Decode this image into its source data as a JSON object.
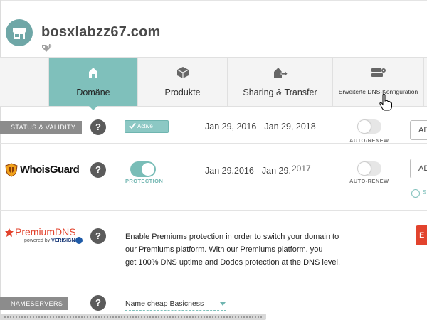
{
  "header": {
    "domain": "bosxlabzz67.com"
  },
  "tabs": [
    {
      "label": "Domäne",
      "icon": "home-icon",
      "active": true
    },
    {
      "label": "Produkte",
      "icon": "box-icon",
      "active": false
    },
    {
      "label": "Sharing & Transfer",
      "icon": "house-arrow-icon",
      "active": false
    },
    {
      "label": "Erweiterte DNS-Konfiguration",
      "icon": "server-gear-icon",
      "active": false
    }
  ],
  "status_row": {
    "label": "STATUS & VALIDITY",
    "help": "?",
    "badge": "Active",
    "dates": "Jan 29, 2016 - Jan 29, 2018",
    "auto_renew_label": "AUTO-RENEW",
    "auto_renew_on": false,
    "edge_button": "AD"
  },
  "whoisguard_row": {
    "logo_text": "WhoisGuard",
    "help": "?",
    "protection_label": "PROTECTION",
    "protection_on": true,
    "date_main": "Jan 29.2016 -  Jan 29.",
    "date_year": "2017",
    "auto_renew_label": "AUTO-RENEW",
    "auto_renew_on": false,
    "edge_button": "AD",
    "edge_text": "S"
  },
  "premiumdns_row": {
    "logo_text": "PremiumDNS",
    "powered_by": "powered by",
    "powered_brand": "VERISIGN",
    "help": "?",
    "description": [
      "Enable Premiums protection in order to switch your domain to",
      "our Premiums platform. With our Premiums platform. you",
      "get 100% DNS uptime and Dodos protection at the DNS level."
    ],
    "edge_button": "E"
  },
  "nameservers_row": {
    "label": "NAMESERVERS",
    "help": "?",
    "selected": "Name cheap Basicness"
  },
  "colors": {
    "accent": "#7fc0bb",
    "label_gray": "#8c8c8c",
    "premium_red": "#e2432d"
  }
}
